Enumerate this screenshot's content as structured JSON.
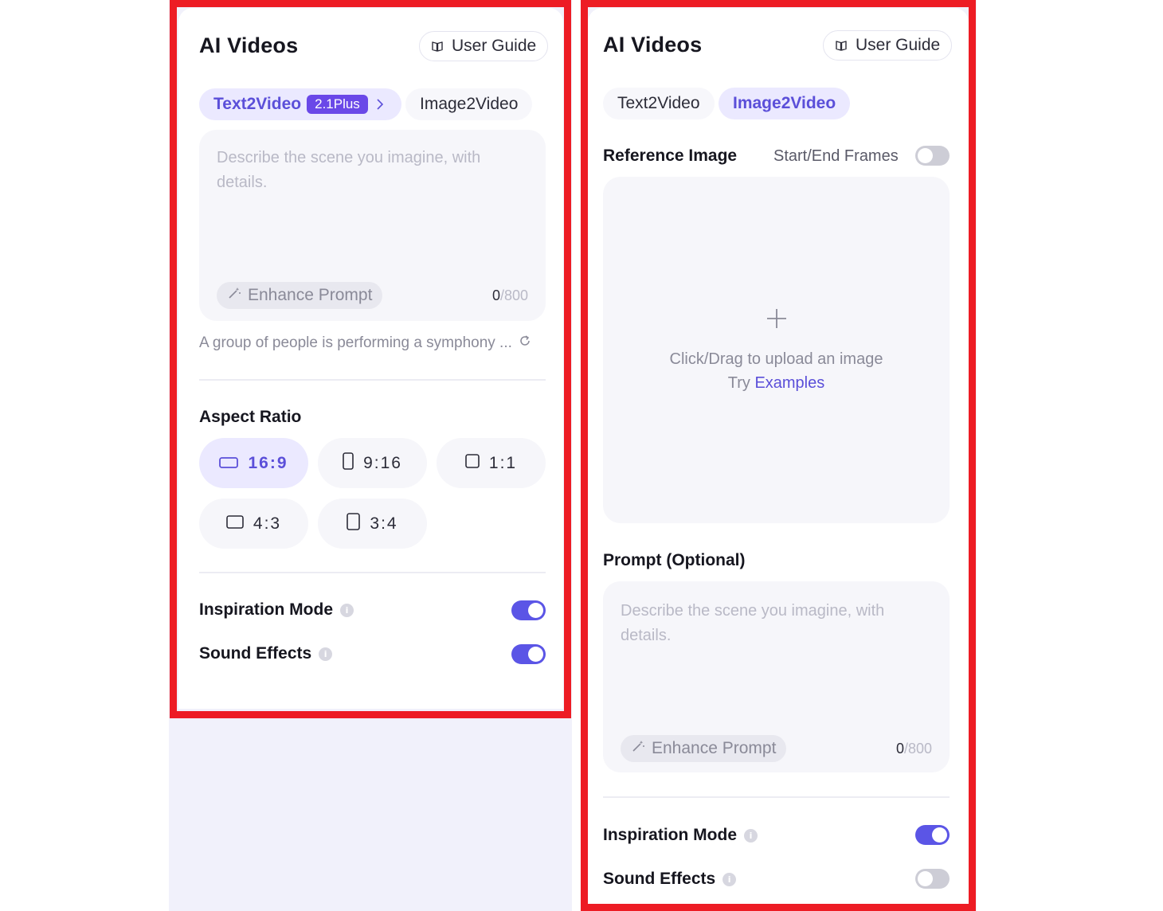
{
  "left_panel": {
    "title": "AI Videos",
    "user_guide": "User Guide",
    "tabs": [
      {
        "label": "Text2Video",
        "badge": "2.1Plus",
        "active": true
      },
      {
        "label": "Image2Video",
        "active": false
      }
    ],
    "prompt": {
      "placeholder": "Describe the scene you imagine, with details.",
      "enhance_label": "Enhance Prompt",
      "count": "0",
      "max": "/800"
    },
    "sample_prompt": "A group of people is performing a symphony ...",
    "aspect_ratio": {
      "label": "Aspect Ratio",
      "options": [
        {
          "label": "16:9",
          "icon": "landscape-icon",
          "selected": true
        },
        {
          "label": "9:16",
          "icon": "portrait-icon",
          "selected": false
        },
        {
          "label": "1:1",
          "icon": "square-icon",
          "selected": false
        },
        {
          "label": "4:3",
          "icon": "landscape-icon",
          "selected": false
        },
        {
          "label": "3:4",
          "icon": "portrait-icon",
          "selected": false
        }
      ]
    },
    "inspiration_mode": {
      "label": "Inspiration Mode",
      "on": true
    },
    "sound_effects": {
      "label": "Sound Effects",
      "on": true
    }
  },
  "right_panel": {
    "title": "AI Videos",
    "user_guide": "User Guide",
    "tabs": [
      {
        "label": "Text2Video",
        "active": false
      },
      {
        "label": "Image2Video",
        "active": true
      }
    ],
    "reference_image": {
      "label": "Reference Image",
      "frames_label": "Start/End Frames",
      "frames_on": false,
      "upload_text": "Click/Drag to upload an image",
      "try_text": "Try",
      "examples_link": "Examples"
    },
    "prompt": {
      "label": "Prompt (Optional)",
      "placeholder": "Describe the scene you imagine, with details.",
      "enhance_label": "Enhance Prompt",
      "count": "0",
      "max": "/800"
    },
    "inspiration_mode": {
      "label": "Inspiration Mode",
      "on": true
    },
    "sound_effects": {
      "label": "Sound Effects",
      "on": false
    }
  },
  "colors": {
    "accent": "#5b55e6",
    "accent_text": "#5b4fd9",
    "badge": "#6a48e8",
    "highlight_frame": "#ed1c24"
  }
}
